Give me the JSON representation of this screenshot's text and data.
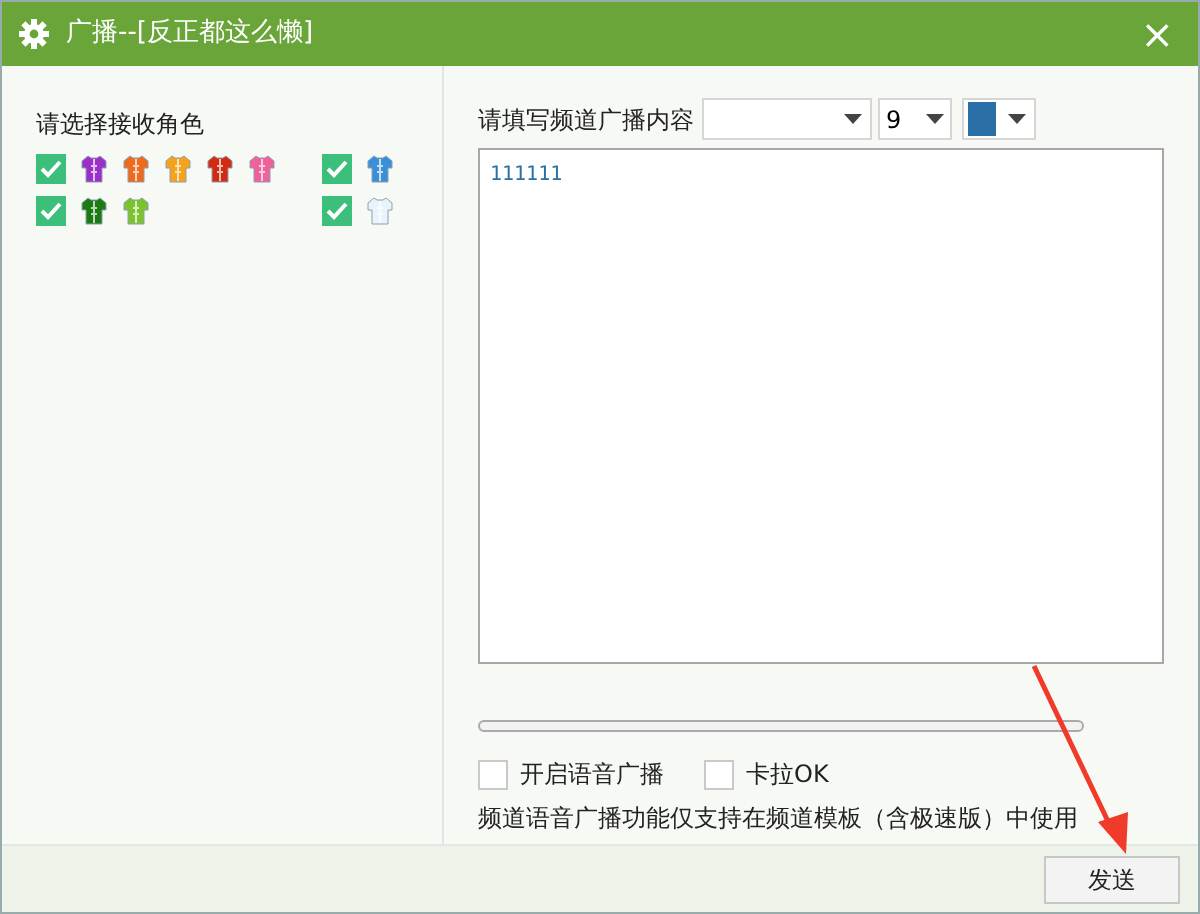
{
  "window": {
    "title": "广播--[反正都这么懒]",
    "close": "×"
  },
  "roles": {
    "label": "请选择接收角色",
    "rows": [
      {
        "groups": [
          {
            "checked": true,
            "shirts": [
              {
                "color": "#9b30c8"
              },
              {
                "color": "#f06a1c"
              },
              {
                "color": "#f7a21b"
              },
              {
                "color": "#d22b12"
              },
              {
                "color": "#f0609a"
              }
            ]
          },
          {
            "checked": true,
            "shirts": [
              {
                "color": "#3a8fd8"
              }
            ]
          }
        ]
      },
      {
        "groups": [
          {
            "checked": true,
            "shirts": [
              {
                "color": "#1d7a12"
              },
              {
                "color": "#7cc22c"
              }
            ]
          },
          {
            "checked": true,
            "shirts": [
              {
                "color": "#e8f3fb"
              }
            ]
          }
        ]
      }
    ]
  },
  "content": {
    "label": "请填写频道广播内容",
    "font_size": "9",
    "color": "#2a6fa6",
    "text": "111111"
  },
  "options": [
    {
      "label": "开启语音广播",
      "checked": false
    },
    {
      "label": "卡拉OK",
      "checked": false
    }
  ],
  "note": "频道语音广播功能仅支持在频道模板（含极速版）中使用",
  "send_button": "发送"
}
